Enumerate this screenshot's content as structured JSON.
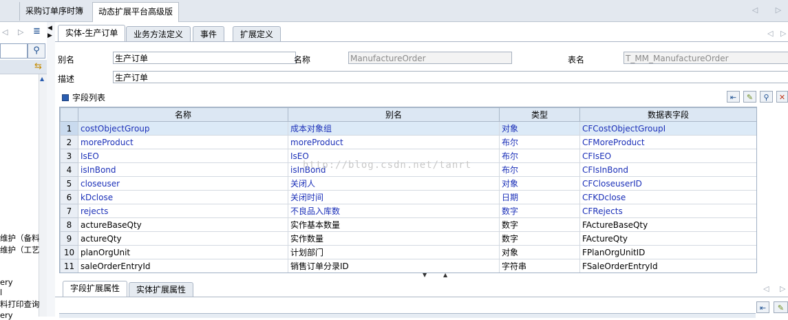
{
  "top_tabs": [
    {
      "label": "采购订单序时簿"
    },
    {
      "label": "动态扩展平台高级版"
    }
  ],
  "left_panel": {
    "items": [
      "维护（备料",
      "维护（工艺",
      "ery",
      "l",
      "料打印查询",
      "ery"
    ]
  },
  "main_tabs": [
    {
      "label": "实体-生产订单"
    },
    {
      "label": "业务方法定义"
    },
    {
      "label": "事件"
    },
    {
      "label": "扩展定义"
    }
  ],
  "form": {
    "alias_label": "别名",
    "alias_value": "生产订单",
    "name_label": "名称",
    "name_value": "ManufactureOrder",
    "table_label": "表名",
    "table_value": "T_MM_ManufactureOrder",
    "desc_label": "描述",
    "desc_value": "生产订单"
  },
  "field_list": {
    "title": "字段列表",
    "columns": [
      "名称",
      "别名",
      "类型",
      "数据表字段"
    ],
    "rows": [
      {
        "n": "1",
        "name": "costObjectGroup",
        "alias": "成本对象组",
        "type": "对象",
        "field": "CFCostObjectGroupI"
      },
      {
        "n": "2",
        "name": "moreProduct",
        "alias": "moreProduct",
        "type": "布尔",
        "field": "CFMoreProduct"
      },
      {
        "n": "3",
        "name": "IsEO",
        "alias": "IsEO",
        "type": "布尔",
        "field": "CFIsEO"
      },
      {
        "n": "4",
        "name": "isInBond",
        "alias": "isInBond",
        "type": "布尔",
        "field": "CFIsInBond"
      },
      {
        "n": "5",
        "name": "closeuser",
        "alias": "关闭人",
        "type": "对象",
        "field": "CFCloseuserID"
      },
      {
        "n": "6",
        "name": "kDclose",
        "alias": "关闭时间",
        "type": "日期",
        "field": "CFKDclose"
      },
      {
        "n": "7",
        "name": "rejects",
        "alias": "不良品入库数",
        "type": "数字",
        "field": "CFRejects"
      },
      {
        "n": "8",
        "name": "actureBaseQty",
        "alias": "实作基本数量",
        "type": "数字",
        "field": "FActureBaseQty"
      },
      {
        "n": "9",
        "name": "actureQty",
        "alias": "实作数量",
        "type": "数字",
        "field": "FActureQty"
      },
      {
        "n": "10",
        "name": "planOrgUnit",
        "alias": "计划部门",
        "type": "对象",
        "field": "FPlanOrgUnitID"
      },
      {
        "n": "11",
        "name": "saleOrderEntryId",
        "alias": "销售订单分录ID",
        "type": "字符串",
        "field": "FSaleOrderEntryId"
      }
    ]
  },
  "watermark": "http://blog.csdn.net/tanrt",
  "bottom_tabs": [
    {
      "label": "字段扩展属性"
    },
    {
      "label": "实体扩展属性"
    }
  ],
  "colors": {
    "custom_field_text": "#1a2fb8",
    "selected_row": "#dceaf7",
    "header_bg": "#dce7f3"
  }
}
